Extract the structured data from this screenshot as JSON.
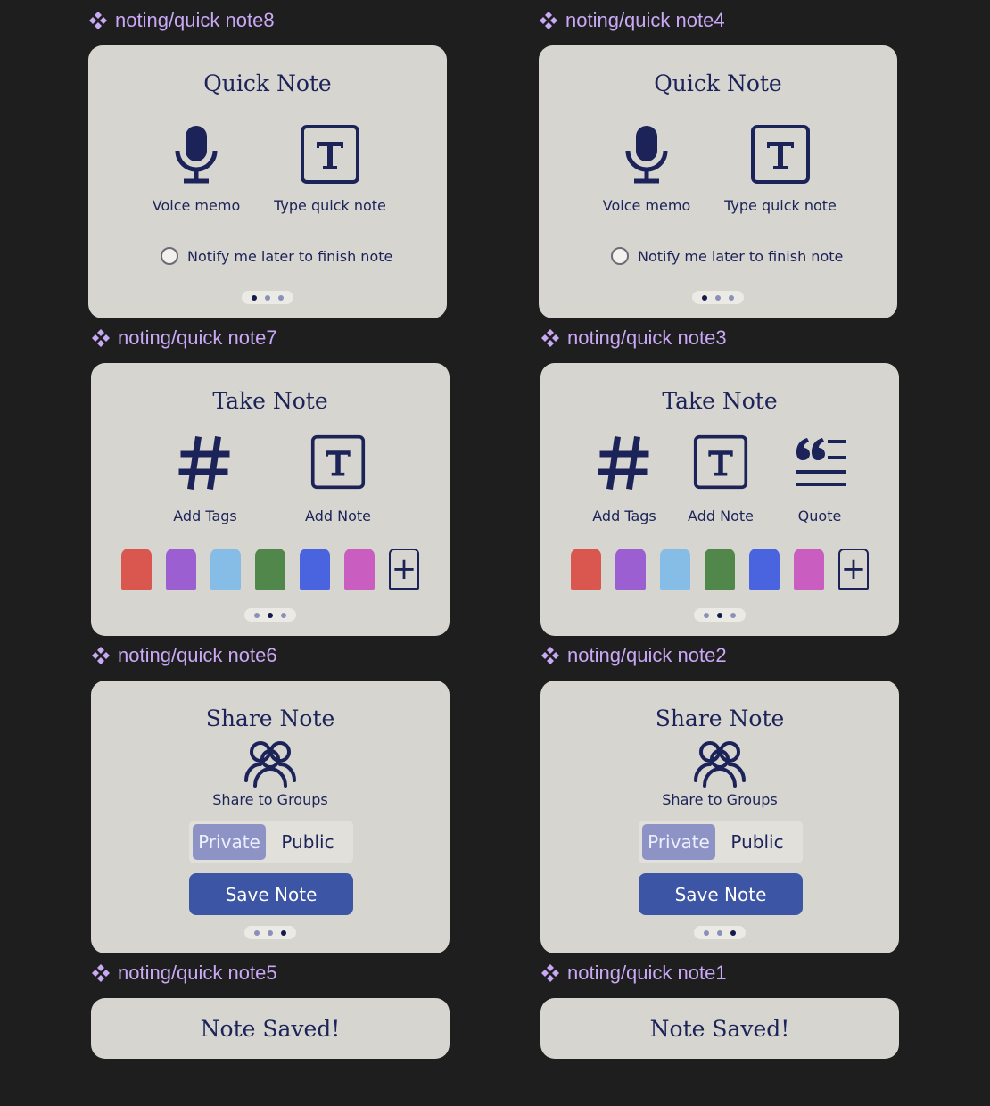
{
  "frames": {
    "note8": "noting/quick note8",
    "note4": "noting/quick note4",
    "note7": "noting/quick note7",
    "note3": "noting/quick note3",
    "note6": "noting/quick note6",
    "note2": "noting/quick note2",
    "note5": "noting/quick note5",
    "note1": "noting/quick note1"
  },
  "quick_note": {
    "title": "Quick Note",
    "voice_label": "Voice memo",
    "type_label": "Type quick note",
    "notify_label": "Notify me later to finish note",
    "active_page": 1
  },
  "take_note": {
    "title": "Take Note",
    "tags_label": "Add Tags",
    "add_note_label": "Add Note",
    "quote_label": "Quote",
    "active_page": 2,
    "swatches": [
      "#d9574f",
      "#9b5fd1",
      "#86bde6",
      "#52874c",
      "#4a64e0",
      "#c95ec0"
    ]
  },
  "share_note": {
    "title": "Share Note",
    "groups_label": "Share to Groups",
    "private_label": "Private",
    "public_label": "Public",
    "save_label": "Save Note",
    "active_page": 3
  },
  "saved": {
    "message": "Note Saved!"
  },
  "colors": {
    "accent": "#3d55a5",
    "ink": "#1b2358",
    "label": "#c9a8f5",
    "card": "#d7d5d0"
  }
}
